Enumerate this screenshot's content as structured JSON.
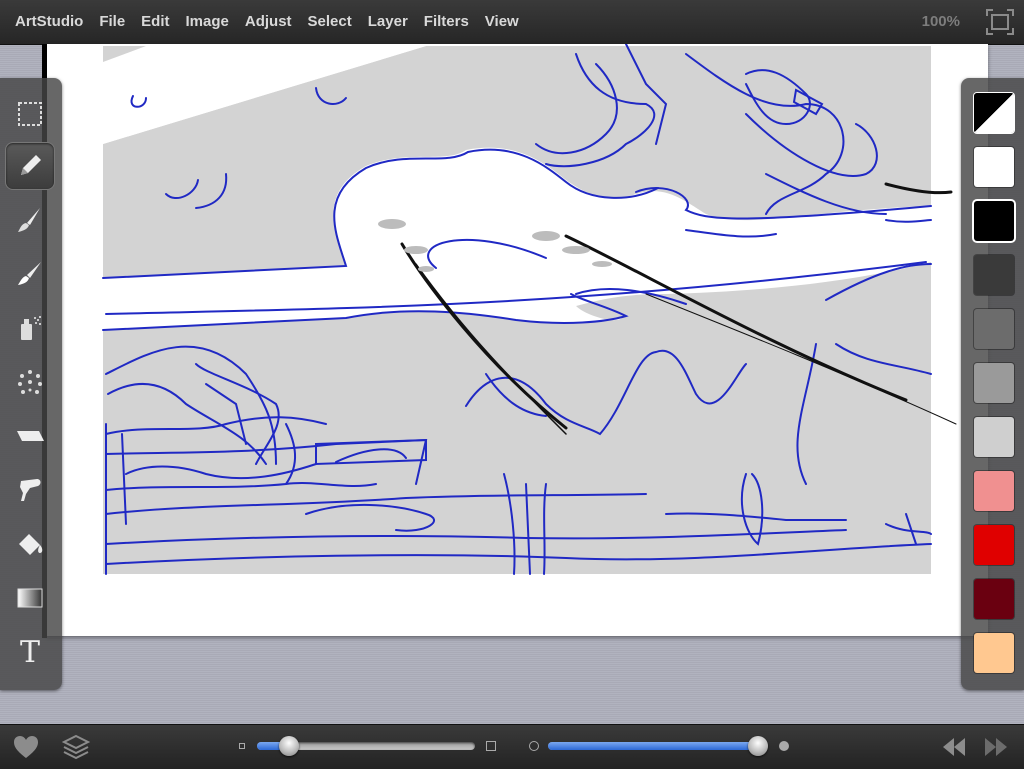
{
  "menubar": {
    "app_name": "ArtStudio",
    "items": [
      "File",
      "Edit",
      "Image",
      "Adjust",
      "Select",
      "Layer",
      "Filters",
      "View"
    ],
    "zoom": "100%",
    "fullscreen_icon": "fullscreen-icon"
  },
  "toolbar": {
    "tools": [
      {
        "name": "selection-tool",
        "icon": "marquee-select-icon"
      },
      {
        "name": "pencil-tool",
        "icon": "pencil-icon",
        "selected": true
      },
      {
        "name": "brush-tool",
        "icon": "brush-icon"
      },
      {
        "name": "smudge-tool",
        "icon": "smudge-brush-icon"
      },
      {
        "name": "spray-tool",
        "icon": "spray-can-icon"
      },
      {
        "name": "scatter-tool",
        "icon": "scatter-dots-icon"
      },
      {
        "name": "eraser-tool",
        "icon": "eraser-icon"
      },
      {
        "name": "stamp-tool",
        "icon": "clone-stamp-icon"
      },
      {
        "name": "fill-tool",
        "icon": "paint-bucket-icon"
      },
      {
        "name": "gradient-tool",
        "icon": "gradient-icon"
      },
      {
        "name": "text-tool",
        "icon": "text-icon",
        "label": "T"
      }
    ]
  },
  "palette": {
    "colors": [
      "#ffffff",
      "#000000",
      "#3a3a3a",
      "#6c6c6c",
      "#9a9a9a",
      "#cfcfcf",
      "#f09090",
      "#e00000",
      "#6a0010",
      "#ffc890"
    ],
    "selected_index": 1,
    "fg_bg_swatch": "foreground-background-swatch"
  },
  "bottombar": {
    "favorites_icon": "heart-icon",
    "layers_icon": "layers-icon",
    "brush_size": 0.11,
    "opacity": 1.0,
    "undo_icon": "rewind-icon",
    "redo_icon": "fast-forward-icon"
  },
  "canvas": {
    "sketch_color": "#2029c4",
    "fill_color": "#d3d3d3"
  }
}
